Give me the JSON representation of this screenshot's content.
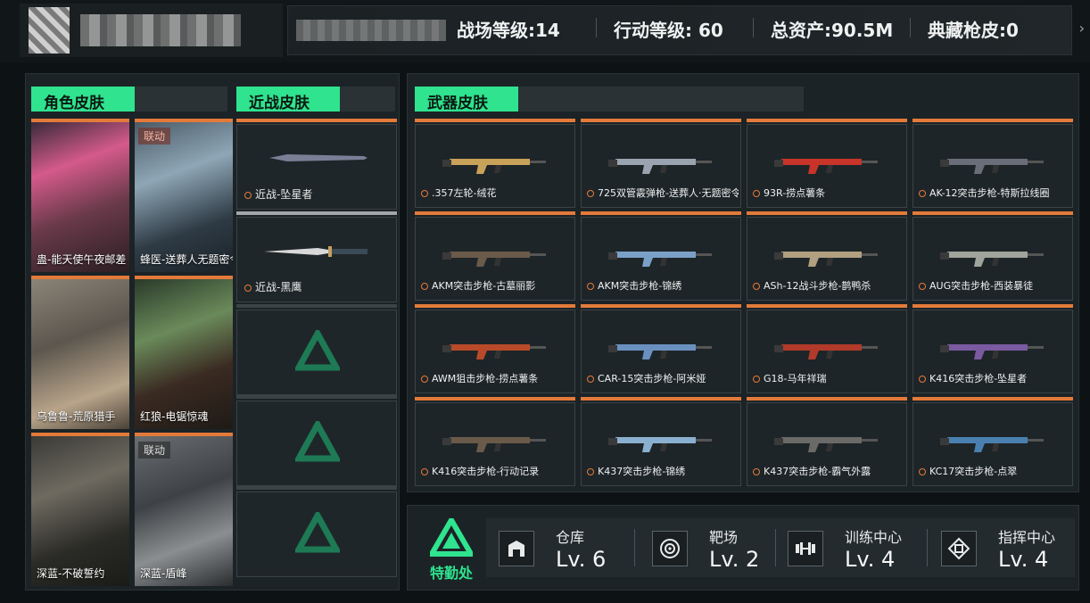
{
  "header": {
    "stats": [
      {
        "label": "战场等级:14"
      },
      {
        "label": "行动等级: 60"
      },
      {
        "label": "总资产:90.5M"
      },
      {
        "label": "典藏枪皮:0"
      }
    ]
  },
  "sections": {
    "character": "角色皮肤",
    "melee": "近战皮肤",
    "weapon": "武器皮肤"
  },
  "characters": [
    {
      "label": "蛊-能天使午夜邮差",
      "tag": ""
    },
    {
      "label": "蜂医-送葬人无题密令",
      "tag": "联动"
    },
    {
      "label": "乌鲁鲁-荒原猎手",
      "tag": ""
    },
    {
      "label": "红狼-电锯惊魂",
      "tag": ""
    },
    {
      "label": "深蓝-不破誓约",
      "tag": ""
    },
    {
      "label": "深蓝-盾峰",
      "tag": "联动"
    }
  ],
  "melee": [
    {
      "label": "近战-坠星者"
    },
    {
      "label": "近战-黑鹰"
    },
    {
      "label": ""
    },
    {
      "label": ""
    },
    {
      "label": ""
    }
  ],
  "weapons": [
    {
      "label": ".357左轮-绒花"
    },
    {
      "label": "725双管霰弹枪-送葬人·无题密令"
    },
    {
      "label": "93R-捞点薯条"
    },
    {
      "label": "AK-12突击步枪-特斯拉线圈"
    },
    {
      "label": "AKM突击步枪-古墓丽影"
    },
    {
      "label": "AKM突击步枪-锦绣"
    },
    {
      "label": "ASh-12战斗步枪-鹊鸭杀"
    },
    {
      "label": "AUG突击步枪-西装暴徒"
    },
    {
      "label": "AWM狙击步枪-捞点薯条"
    },
    {
      "label": "CAR-15突击步枪-阿米娅"
    },
    {
      "label": "G18-马年祥瑞"
    },
    {
      "label": "K416突击步枪-坠星者"
    },
    {
      "label": "K416突击步枪-行动记录"
    },
    {
      "label": "K437突击步枪-锦绣"
    },
    {
      "label": "K437突击步枪-霸气外露"
    },
    {
      "label": "KC17突击步枪-点翠"
    }
  ],
  "facilities": {
    "hq_label": "特勤处",
    "items": [
      {
        "name": "仓库",
        "level": "Lv. 6",
        "icon": "warehouse-icon"
      },
      {
        "name": "靶场",
        "level": "Lv. 2",
        "icon": "target-icon"
      },
      {
        "name": "训练中心",
        "level": "Lv. 4",
        "icon": "dumbbell-icon"
      },
      {
        "name": "指挥中心",
        "level": "Lv. 4",
        "icon": "command-icon"
      }
    ]
  },
  "colors": {
    "accent": "#2fe38f",
    "rarity": "#e37a3a",
    "panel": "#1c2326"
  }
}
